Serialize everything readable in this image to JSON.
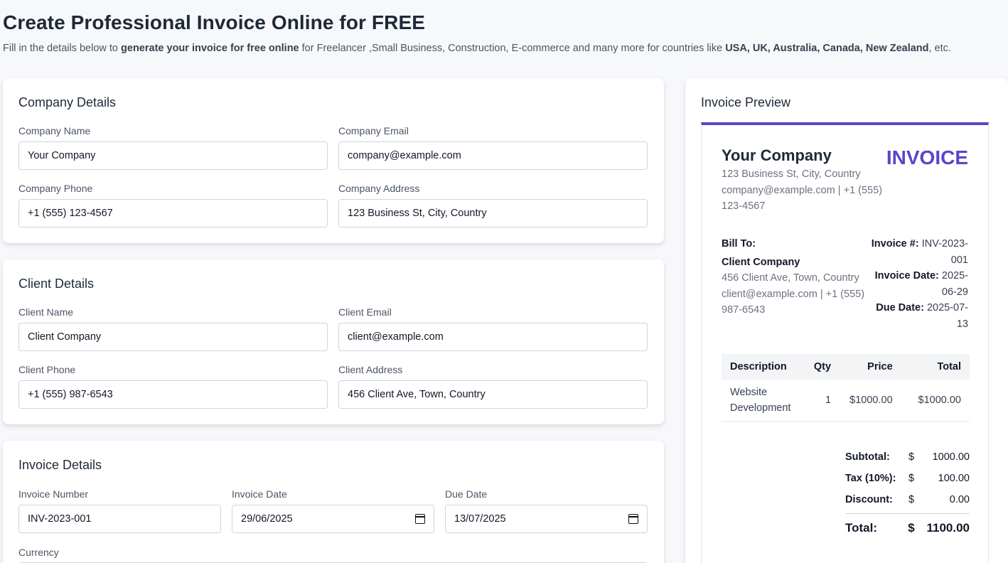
{
  "header": {
    "title": "Create Professional Invoice Online for FREE",
    "intro_part1": "Fill in the details below to ",
    "intro_bold1": "generate your invoice for free online",
    "intro_part2": " for Freelancer ,Small Business, Construction, E-commerce and many more for countries like ",
    "intro_bold2": "USA, UK, Australia, Canada, New Zealand",
    "intro_part3": ", etc."
  },
  "company": {
    "title": "Company Details",
    "name_label": "Company Name",
    "name_value": "Your Company",
    "email_label": "Company Email",
    "email_value": "company@example.com",
    "phone_label": "Company Phone",
    "phone_value": "+1 (555) 123-4567",
    "address_label": "Company Address",
    "address_value": "123 Business St, City, Country"
  },
  "client": {
    "title": "Client Details",
    "name_label": "Client Name",
    "name_value": "Client Company",
    "email_label": "Client Email",
    "email_value": "client@example.com",
    "phone_label": "Client Phone",
    "phone_value": "+1 (555) 987-6543",
    "address_label": "Client Address",
    "address_value": "456 Client Ave, Town, Country"
  },
  "invoice": {
    "title": "Invoice Details",
    "number_label": "Invoice Number",
    "number_value": "INV-2023-001",
    "date_label": "Invoice Date",
    "date_value": "29/06/2025",
    "due_label": "Due Date",
    "due_value": "13/07/2025",
    "currency_label": "Currency"
  },
  "preview": {
    "title": "Invoice Preview",
    "company_name": "Your Company",
    "invoice_word": "INVOICE",
    "company_address": "123 Business St, City, Country",
    "company_contact": "company@example.com | +1 (555) 123-4567",
    "bill_to_label": "Bill To:",
    "client_name": "Client Company",
    "client_address": "456 Client Ave, Town, Country",
    "client_contact": "client@example.com | +1 (555) 987-6543",
    "invoice_no_label": "Invoice #:",
    "invoice_no": "INV-2023-001",
    "invoice_date_label": "Invoice Date:",
    "invoice_date": "2025-06-29",
    "due_date_label": "Due Date:",
    "due_date": "2025-07-13",
    "table_headers": [
      "Description",
      "Qty",
      "Price",
      "Total"
    ],
    "items": [
      {
        "description": "Website Development",
        "qty": "1",
        "price": "$1000.00",
        "total": "$1000.00"
      }
    ],
    "subtotal_label": "Subtotal:",
    "subtotal_currency": "$",
    "subtotal": "1000.00",
    "tax_label": "Tax (10%):",
    "tax_currency": "$",
    "tax": "100.00",
    "discount_label": "Discount:",
    "discount_currency": "$",
    "discount": "0.00",
    "total_label": "Total:",
    "total_currency": "$",
    "total": "1100.00"
  },
  "colors": {
    "accent": "#5b45c9",
    "background": "#f7f8fb"
  },
  "icons": {
    "date_picker": "calendar-icon"
  }
}
